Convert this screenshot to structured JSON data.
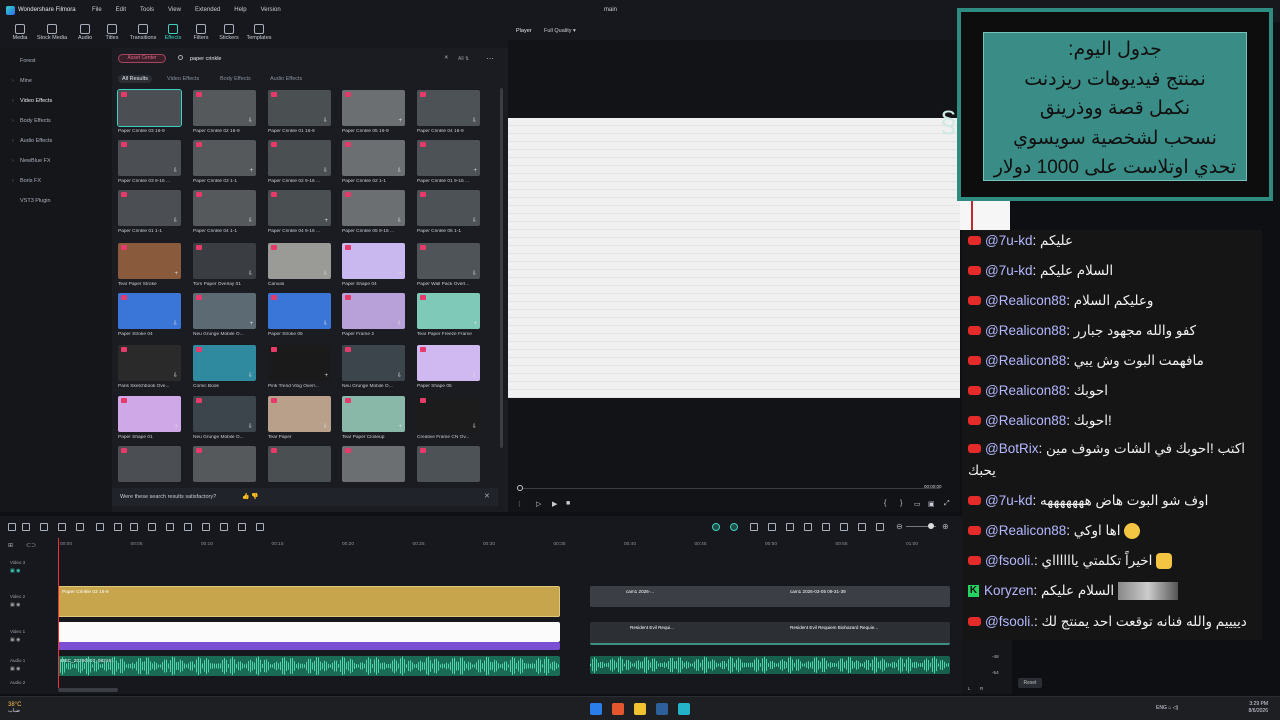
{
  "app": {
    "name": "Wondershare Filmora",
    "document_title": "main",
    "menu": [
      "File",
      "Edit",
      "Tools",
      "View",
      "Extended",
      "Help",
      "Version"
    ]
  },
  "toolbar": {
    "items": [
      {
        "label": "Media",
        "icon": "media-icon"
      },
      {
        "label": "Stock Media",
        "icon": "stock-media-icon"
      },
      {
        "label": "Audio",
        "icon": "audio-icon"
      },
      {
        "label": "Titles",
        "icon": "titles-icon"
      },
      {
        "label": "Transitions",
        "icon": "transitions-icon"
      },
      {
        "label": "Effects",
        "icon": "effects-icon",
        "active": true
      },
      {
        "label": "Filters",
        "icon": "filters-icon"
      },
      {
        "label": "Stickers",
        "icon": "stickers-icon"
      },
      {
        "label": "Templates",
        "icon": "templates-icon"
      }
    ]
  },
  "sidebar": {
    "items": [
      {
        "label": "Forest",
        "expandable": false
      },
      {
        "label": "Mine",
        "expandable": true
      },
      {
        "label": "Video Effects",
        "expandable": true,
        "active": true
      },
      {
        "label": "Body Effects",
        "expandable": true
      },
      {
        "label": "Audio Effects",
        "expandable": true
      },
      {
        "label": "NewBlue FX",
        "expandable": true
      },
      {
        "label": "Boris FX",
        "expandable": true
      },
      {
        "label": "VST3 Plugin",
        "expandable": false
      }
    ]
  },
  "browser": {
    "asset_center_label": "Asset Center",
    "search_value": "paper crinkle",
    "filter_label": "All",
    "filter_tabs": [
      "All Results",
      "Video Effects",
      "Body Effects",
      "Audio Effects"
    ],
    "tiles": [
      "Paper Crinkle 03 16-9",
      "Paper Crinkle 02 16-9",
      "Paper Crinkle 01 16-9",
      "Paper Crinkle 05 16-9",
      "Paper Crinkle 04 16-9",
      "Paper Crinkle 03 9-16 ...",
      "Paper Crinkle 03 1-1",
      "Paper Crinkle 02 9-16 ...",
      "Paper Crinkle 02 1-1",
      "Paper Crinkle 01 9-16 ...",
      "Paper Crinkle 01 1-1",
      "Paper Crinkle 04 1-1",
      "Paper Crinkle 04 9-16 ...",
      "Paper Crinkle 05 9-16 ...",
      "Paper Crinkle 05 1-1",
      "Tear Paper Stroke",
      "Torn Paper Overlay 01",
      "Canvas",
      "Paper Shape 04",
      "Paper Wall Pack Overl...",
      "Paper Stroke 04",
      "Neu Grunge Mobile O...",
      "Paper Stroke 05",
      "Paper Frame 2",
      "Tear Paper Freeze Frame",
      "Paris Sketchbook Ove...",
      "Comic Book",
      "Pink Trend Vlog Overl...",
      "Neu Grunge Mobile O...",
      "Paper Shape 05",
      "Paper Shape 01",
      "Neu Grunge Mobile O...",
      "Tear Paper",
      "Tear Paper Closeup",
      "Creative Frame CN Ov...",
      "",
      "",
      "",
      "",
      ""
    ],
    "feedback_text": "Were these search results satisfactory?"
  },
  "player": {
    "label": "Player",
    "quality": "Full Quality",
    "time": "00:00:00"
  },
  "overlay": {
    "lines": [
      "جدول اليوم:",
      "نمنتج فيديوهات ريزدنت",
      "نكمل قصة ووذرينق",
      "نسحب لشخصية سويسوي",
      "تحدي اوتلاست على 1000 دولار"
    ]
  },
  "chat": {
    "messages": [
      {
        "platform": "youtube",
        "user": "@7u-kd",
        "text": "عليكم"
      },
      {
        "platform": "youtube",
        "user": "@7u-kd",
        "text": "السلام عليكم"
      },
      {
        "platform": "youtube",
        "user": "@Realicon88",
        "text": "وعليكم السلام"
      },
      {
        "platform": "youtube",
        "user": "@Realicon88",
        "text": "كفو والله مجهود جبارر"
      },
      {
        "platform": "youtube",
        "user": "@Realicon88",
        "text": "مافهمت البوت وش يبي"
      },
      {
        "platform": "youtube",
        "user": "@Realicon88",
        "text": "احوبك"
      },
      {
        "platform": "youtube",
        "user": "@Realicon88",
        "text": "!احوبك"
      },
      {
        "platform": "youtube",
        "user": "@BotRix",
        "text": "اكتب !احوبك في الشات وشوف مين يحبك"
      },
      {
        "platform": "youtube",
        "user": "@7u-kd",
        "text": "اوف شو البوت هاض هههههههه"
      },
      {
        "platform": "youtube",
        "user": "@Realicon88",
        "text": "اها اوكي"
      },
      {
        "platform": "youtube",
        "user": "@fsooli.",
        "text": "اخيراً تكلمتي يااااااي"
      },
      {
        "platform": "kick",
        "user": "Koryzen",
        "text": "السلام عليكم"
      },
      {
        "platform": "youtube",
        "user": "@fsooli.",
        "text": "دييييم والله فنانه توقعت احد يمنتج لك"
      }
    ]
  },
  "timeline": {
    "ruler": [
      "00:00",
      "00:05",
      "00:10",
      "00:15",
      "00:20",
      "00:25",
      "00:30",
      "00:35",
      "00:40",
      "00:45",
      "00:50",
      "00:55",
      "01:00"
    ],
    "tracks": [
      "Video 3",
      "Video 2",
      "Video 1",
      "Audio 1",
      "Audio 2"
    ],
    "clip_paper_label": "Paper Crinkle 03 16-9",
    "clip_audio_label": "REC_20260803_082151",
    "clip_right_labels": [
      "cam1 2026-...",
      "cam1 2026-03-05 09-31-39",
      "Resident Evil Requi...",
      "Resident Evil Requiem Biohazard Requie..."
    ]
  },
  "meter": {
    "values": [
      "-48",
      "-54"
    ],
    "channels": [
      "L",
      "R"
    ],
    "reset_label": "Reset"
  },
  "taskbar": {
    "temperature": "38°C",
    "weather_label": "ضباب",
    "tray_lang": "ENG",
    "time": "3:29 PM",
    "date": "8/6/2026"
  },
  "colors": {
    "accent": "#3ed2c0",
    "overlay_bg": "#3a8d86",
    "clip_gold": "#c7a54c",
    "clip_purple": "#7a4fd4",
    "youtube_red": "#e52a2a",
    "kick_green": "#23d35f"
  }
}
